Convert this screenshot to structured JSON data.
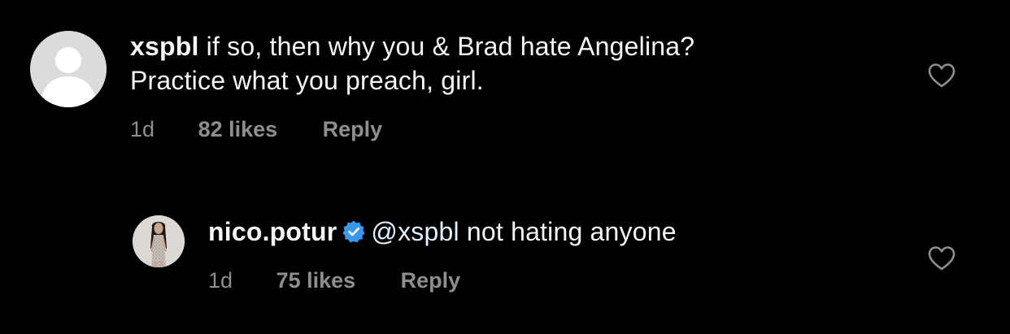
{
  "comment": {
    "username": "xspbl",
    "text_line1": "if so, then why you & Brad hate Angelina?",
    "text_line2": "Practice what you preach, girl.",
    "time": "1d",
    "likes": "82 likes",
    "reply_label": "Reply",
    "avatar_icon": "default-avatar-icon",
    "like_icon": "heart-outline-icon"
  },
  "reply": {
    "username": "nico.potur",
    "verified_icon": "verified-badge-icon",
    "mention": "@xspbl",
    "text": " not hating anyone",
    "time": "1d",
    "likes": "75 likes",
    "reply_label": "Reply",
    "like_icon": "heart-outline-icon"
  },
  "colors": {
    "background": "#000000",
    "text": "#f5f5f5",
    "secondary_text": "#8e8e8e",
    "verified_blue": "#3897f0",
    "mention": "#e0f1ff"
  }
}
